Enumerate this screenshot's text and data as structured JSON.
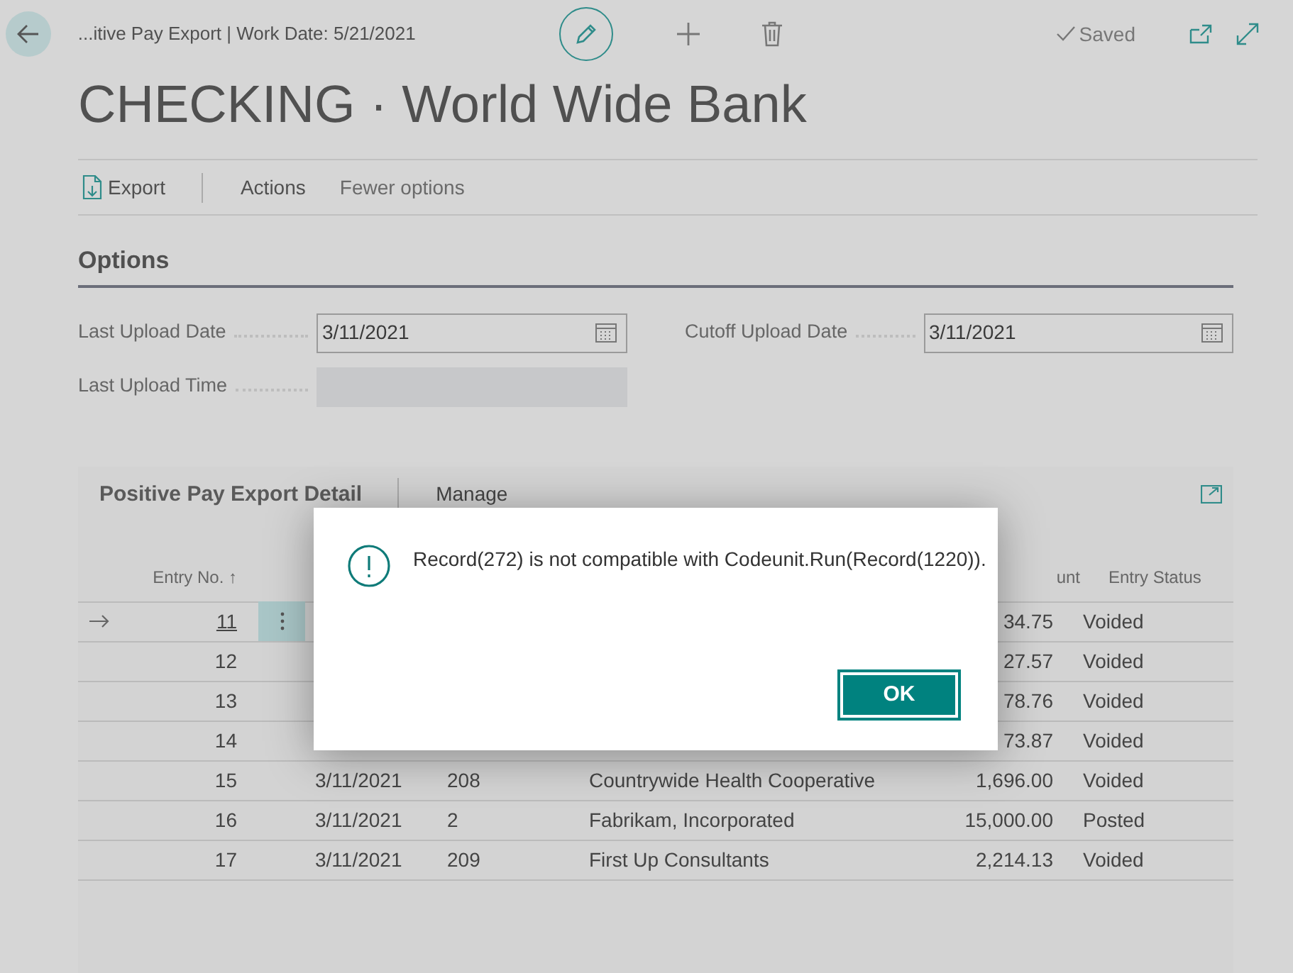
{
  "header": {
    "breadcrumb": "...itive Pay Export | Work Date: 5/21/2021",
    "status": "Saved",
    "title": "CHECKING · World Wide Bank"
  },
  "action_bar": {
    "items": [
      {
        "label": "Export",
        "kind": "icon"
      },
      {
        "label": "Actions",
        "kind": "plain"
      },
      {
        "label": "Fewer options",
        "kind": "plain"
      }
    ]
  },
  "options": {
    "heading": "Options",
    "fields": [
      {
        "label": "Last Upload Date",
        "value": "3/11/2021",
        "kind": "date"
      },
      {
        "label": "Cutoff Upload Date",
        "value": "3/11/2021",
        "kind": "date"
      },
      {
        "label": "Last Upload Time",
        "kind": "readonly"
      }
    ]
  },
  "detail": {
    "title": "Positive Pay Export Detail",
    "action": "Manage",
    "columns": [
      {
        "label": "Entry No. ↑"
      },
      {},
      {},
      {},
      {
        "label": "unt"
      },
      {
        "label": "Entry Status"
      }
    ],
    "rows": [
      {
        "selected": true,
        "cells": [
          "11",
          "",
          "",
          "",
          "34.75",
          "Voided"
        ]
      },
      {
        "selected": false,
        "cells": [
          "12",
          "",
          "",
          "",
          "27.57",
          "Voided"
        ]
      },
      {
        "selected": false,
        "cells": [
          "13",
          "",
          "",
          "",
          "78.76",
          "Voided"
        ]
      },
      {
        "selected": false,
        "cells": [
          "14",
          "",
          "",
          "",
          "73.87",
          "Voided"
        ]
      },
      {
        "selected": false,
        "cells": [
          "15",
          "3/11/2021",
          "208",
          "Countrywide Health Cooperative",
          "1,696.00",
          "Voided"
        ]
      },
      {
        "selected": false,
        "cells": [
          "16",
          "3/11/2021",
          "2",
          "Fabrikam, Incorporated",
          "15,000.00",
          "Posted"
        ]
      },
      {
        "selected": false,
        "cells": [
          "17",
          "3/11/2021",
          "209",
          "First Up Consultants",
          "2,214.13",
          "Voided"
        ]
      }
    ]
  },
  "dialog": {
    "message": "Record(272) is not compatible with Codeunit.Run(Record(1220)).",
    "button": "OK"
  }
}
